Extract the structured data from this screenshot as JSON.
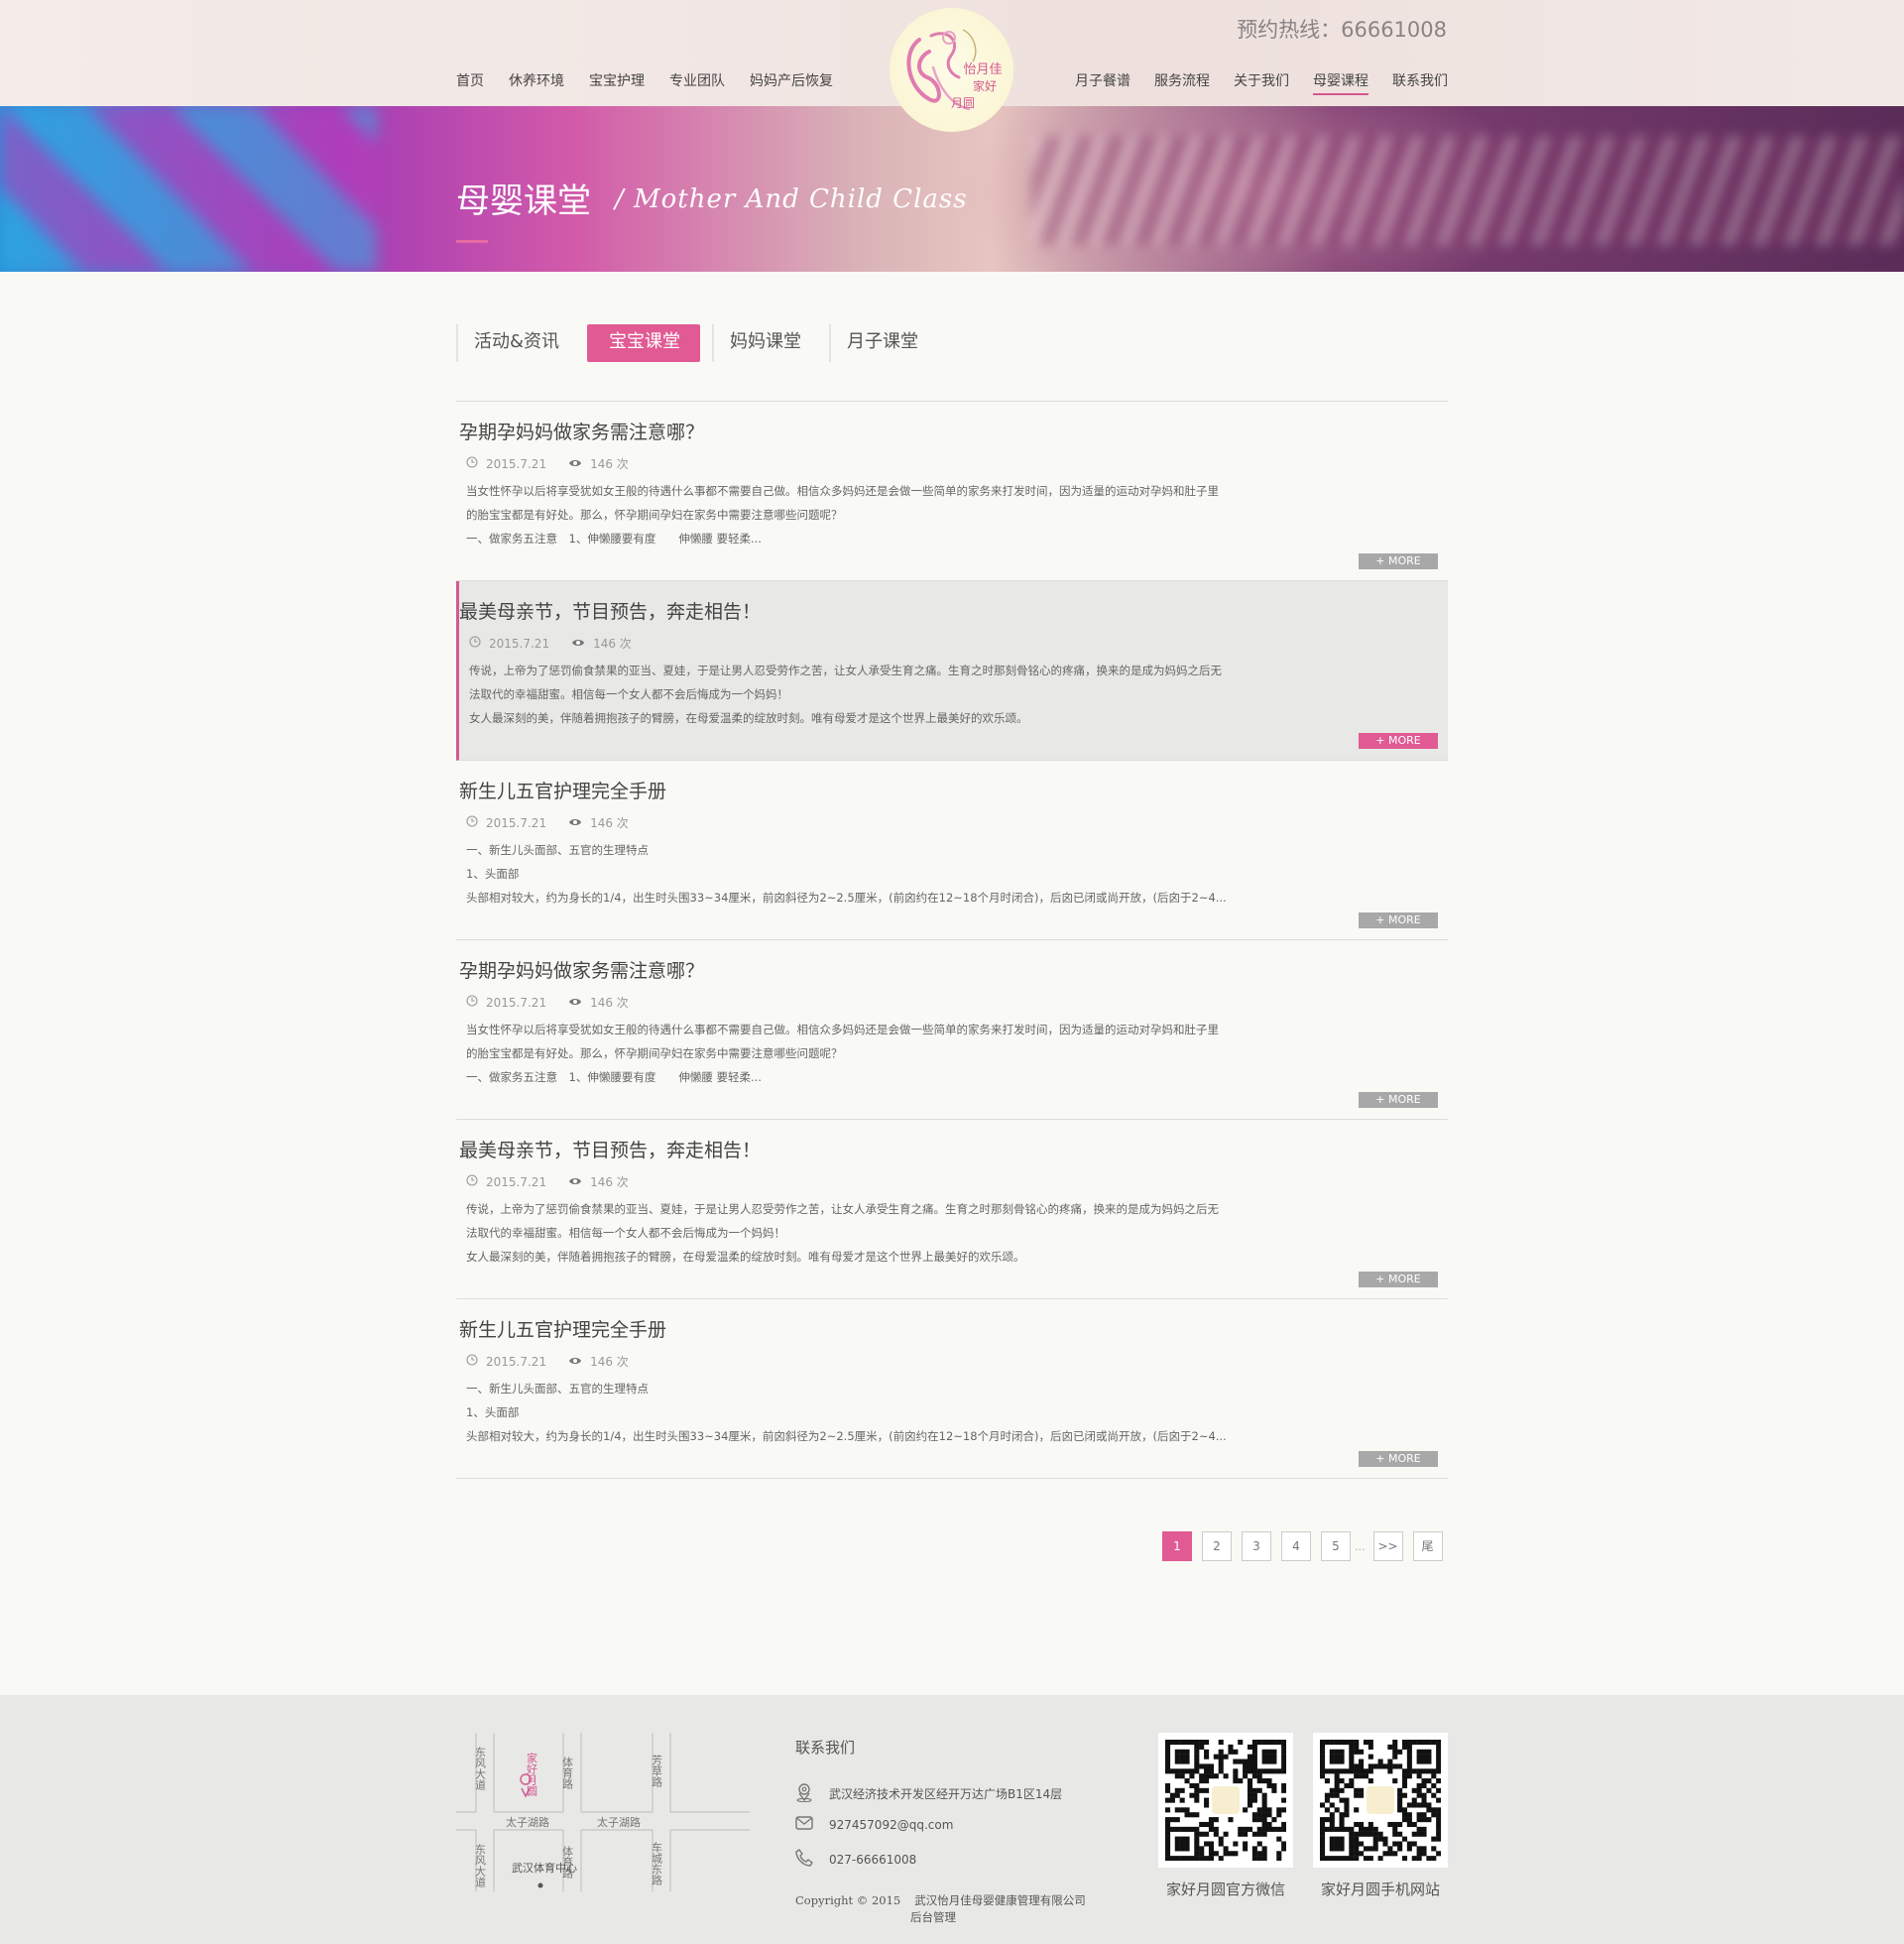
{
  "header": {
    "hotline": "预约热线：66661008",
    "nav_left": [
      "首页",
      "休养环境",
      "宝宝护理",
      "专业团队",
      "妈妈产后恢复"
    ],
    "nav_right": [
      "月子餐谱",
      "服务流程",
      "关于我们",
      "母婴课程",
      "联系我们"
    ],
    "active_nav": "母婴课程",
    "logo_text": "怡月佳家好月圆"
  },
  "banner": {
    "title": "母婴课堂",
    "subtitle": "/ Mother And Child Class"
  },
  "tabs": [
    {
      "label": "活动&资讯",
      "active": false
    },
    {
      "label": "宝宝课堂",
      "active": true
    },
    {
      "label": "妈妈课堂",
      "active": false
    },
    {
      "label": "月子课堂",
      "active": false
    }
  ],
  "articles": [
    {
      "title": "孕期孕妈妈做家务需注意哪？",
      "date": "2015.7.21",
      "views": "146 次",
      "lines": [
        "当女性怀孕以后将享受犹如女王般的待遇什么事都不需要自己做。相信众多妈妈还是会做一些简单的家务来打发时间，因为适量的运动对孕妈和肚子里",
        "的胎宝宝都是有好处。那么，怀孕期间孕妇在家务中需要注意哪些问题呢？",
        "一、做家务五注意　1、伸懒腰要有度　　伸懒腰 要轻柔..."
      ],
      "more": "+ MORE",
      "highlight": false
    },
    {
      "title": "最美母亲节，节目预告，奔走相告！",
      "date": "2015.7.21",
      "views": "146 次",
      "lines": [
        "传说，上帝为了惩罚偷食禁果的亚当、夏娃，于是让男人忍受劳作之苦，让女人承受生育之痛。生育之时那刻骨铭心的疼痛，换来的是成为妈妈之后无",
        "法取代的幸福甜蜜。相信每一个女人都不会后悔成为一个妈妈！",
        "女人最深刻的美，伴随着拥抱孩子的臂膀，在母爱温柔的绽放时刻。唯有母爱才是这个世界上最美好的欢乐颂。"
      ],
      "more": "+ MORE",
      "highlight": true
    },
    {
      "title": "新生儿五官护理完全手册",
      "date": "2015.7.21",
      "views": "146 次",
      "lines": [
        "一、新生儿头面部、五官的生理特点",
        "1、头面部",
        "头部相对较大，约为身长的1/4，出生时头围33~34厘米，前囟斜径为2~2.5厘米，(前囟约在12~18个月时闭合)，后囟已闭或尚开放，(后囟于2~4..."
      ],
      "more": "+ MORE",
      "highlight": false
    },
    {
      "title": "孕期孕妈妈做家务需注意哪？",
      "date": "2015.7.21",
      "views": "146 次",
      "lines": [
        "当女性怀孕以后将享受犹如女王般的待遇什么事都不需要自己做。相信众多妈妈还是会做一些简单的家务来打发时间，因为适量的运动对孕妈和肚子里",
        "的胎宝宝都是有好处。那么，怀孕期间孕妇在家务中需要注意哪些问题呢？",
        "一、做家务五注意　1、伸懒腰要有度　　伸懒腰 要轻柔..."
      ],
      "more": "+ MORE",
      "highlight": false
    },
    {
      "title": "最美母亲节，节目预告，奔走相告！",
      "date": "2015.7.21",
      "views": "146 次",
      "lines": [
        "传说，上帝为了惩罚偷食禁果的亚当、夏娃，于是让男人忍受劳作之苦，让女人承受生育之痛。生育之时那刻骨铭心的疼痛，换来的是成为妈妈之后无",
        "法取代的幸福甜蜜。相信每一个女人都不会后悔成为一个妈妈！",
        "女人最深刻的美，伴随着拥抱孩子的臂膀，在母爱温柔的绽放时刻。唯有母爱才是这个世界上最美好的欢乐颂。"
      ],
      "more": "+ MORE",
      "highlight": false
    },
    {
      "title": "新生儿五官护理完全手册",
      "date": "2015.7.21",
      "views": "146 次",
      "lines": [
        "一、新生儿头面部、五官的生理特点",
        "1、头面部",
        "头部相对较大，约为身长的1/4，出生时头围33~34厘米，前囟斜径为2~2.5厘米，(前囟约在12~18个月时闭合)，后囟已闭或尚开放，(后囟于2~4..."
      ],
      "more": "+ MORE",
      "highlight": false
    }
  ],
  "pagination": {
    "pages": [
      "1",
      "2",
      "3",
      "4",
      "5"
    ],
    "current": "1",
    "dots": "...",
    "next": ">>",
    "last": "尾"
  },
  "footer": {
    "map": {
      "roads": [
        "东风大道",
        "体育路",
        "芳草路",
        "太子湖路",
        "太子湖路",
        "东风大道",
        "体育路",
        "车城东路"
      ],
      "place_home": "家好月圆",
      "place_center": "武汉体育中心"
    },
    "contact_title": "联系我们",
    "address": "武汉经济技术开发区经开万达广场B1区14层",
    "email": "927457092@qq.com",
    "phone": "027-66661008",
    "copyright": "Copyright © 2015",
    "company": "武汉怡月佳母婴健康管理有限公司",
    "admin": "后台管理",
    "qr_wechat_label": "家好月圆官方微信",
    "qr_mobile_label": "家好月圆手机网站"
  },
  "colors": {
    "accent": "#e15a93",
    "more_gray": "#a8a8a8",
    "footer_bg": "#e8e8e6"
  }
}
